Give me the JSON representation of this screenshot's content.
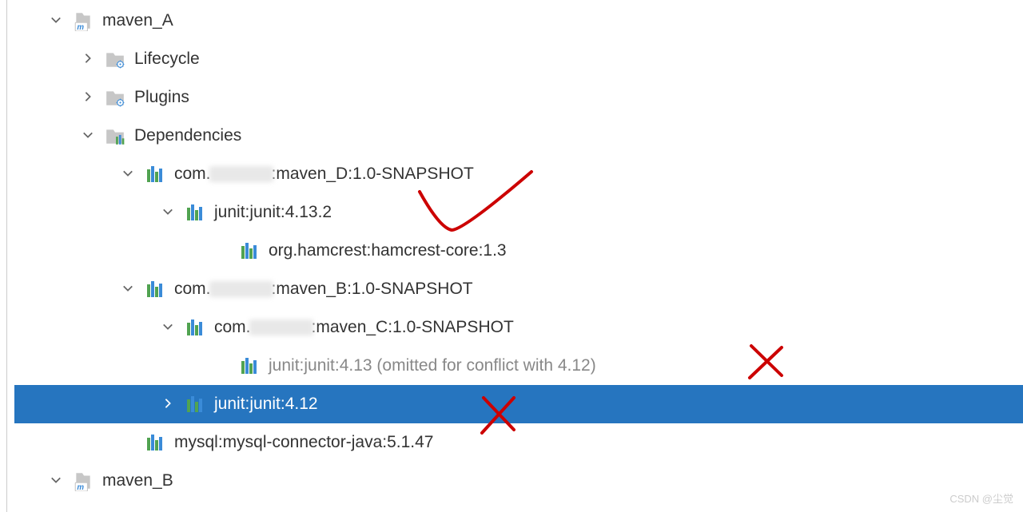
{
  "tree": {
    "maven_A": "maven_A",
    "lifecycle": "Lifecycle",
    "plugins": "Plugins",
    "dependencies": "Dependencies",
    "maven_D": ":maven_D:1.0-SNAPSHOT",
    "maven_D_prefix": "com.",
    "junit_4132": "junit:junit:4.13.2",
    "hamcrest": "org.hamcrest:hamcrest-core:1.3",
    "maven_B_dep": ":maven_B:1.0-SNAPSHOT",
    "maven_B_prefix": "com.",
    "maven_C": ":maven_C:1.0-SNAPSHOT",
    "maven_C_prefix": "com.",
    "junit_413_omitted": "junit:junit:4.13 (omitted for conflict with 4.12)",
    "junit_412": "junit:junit:4.12",
    "mysql": "mysql:mysql-connector-java:5.1.47",
    "maven_B": "maven_B"
  },
  "watermark": "CSDN @尘觉"
}
